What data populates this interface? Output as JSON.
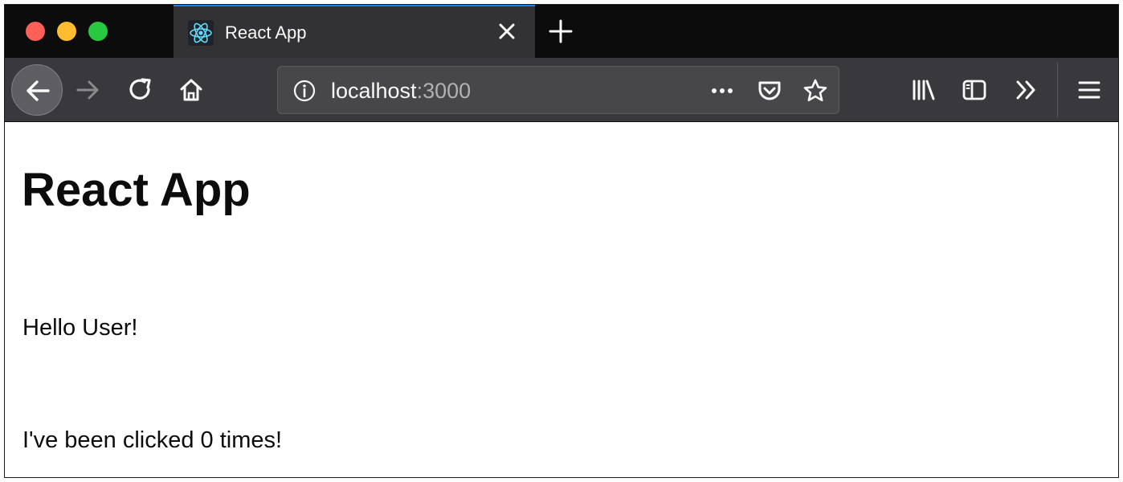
{
  "colors": {
    "tabstrip_bg": "#0c0c0d",
    "active_tab_bg": "#323234",
    "tab_accent": "#0a84ff",
    "navbar_bg": "#38383d",
    "urlbar_bg": "#474749",
    "icon_color": "#f9f9fa",
    "react_logo": "#61dafb",
    "traffic_close": "#fe5f57",
    "traffic_minimize": "#febc2e",
    "traffic_zoom": "#28c840"
  },
  "window": {
    "traffic_lights": [
      "close-window-button",
      "minimize-window-button",
      "zoom-window-button"
    ]
  },
  "tabs": [
    {
      "title": "React App",
      "favicon": "react-logo-icon",
      "active": true,
      "close_icon": "close-icon"
    }
  ],
  "tabstrip": {
    "new_tab_icon": "plus-icon"
  },
  "navbar": {
    "buttons": [
      "back-arrow-icon",
      "forward-arrow-icon",
      "reload-icon",
      "home-icon"
    ],
    "url": {
      "host": "localhost",
      "port": ":3000",
      "info_icon": "info-icon"
    },
    "urlbar_actions": [
      "more-dots-icon",
      "pocket-icon",
      "bookmark-star-icon"
    ],
    "toolbar": [
      "library-icon",
      "sidebar-icon",
      "overflow-chevrons-icon",
      "hamburger-menu-icon"
    ]
  },
  "page": {
    "heading": "React App",
    "greeting": "Hello User!",
    "click_text": "I've been clicked 0 times!"
  }
}
